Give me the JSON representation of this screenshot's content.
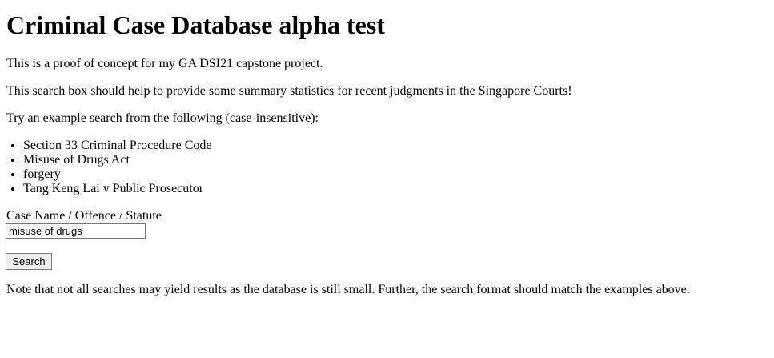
{
  "page": {
    "title": "Criminal Case Database alpha test",
    "intro": "This is a proof of concept for my GA DSI21 capstone project.",
    "description": "This search box should help to provide some summary statistics for recent judgments in the Singapore Courts!",
    "instruction": "Try an example search from the following (case-insensitive):",
    "examples": [
      "Section 33 Criminal Procedure Code",
      "Misuse of Drugs Act",
      "forgery",
      "Tang Keng Lai v Public Prosecutor"
    ]
  },
  "form": {
    "label": "Case Name / Offence / Statute",
    "input_value": "misuse of drugs",
    "button_label": "Search"
  },
  "footer": {
    "note": "Note that not all searches may yield results as the database is still small. Further, the search format should match the examples above."
  }
}
